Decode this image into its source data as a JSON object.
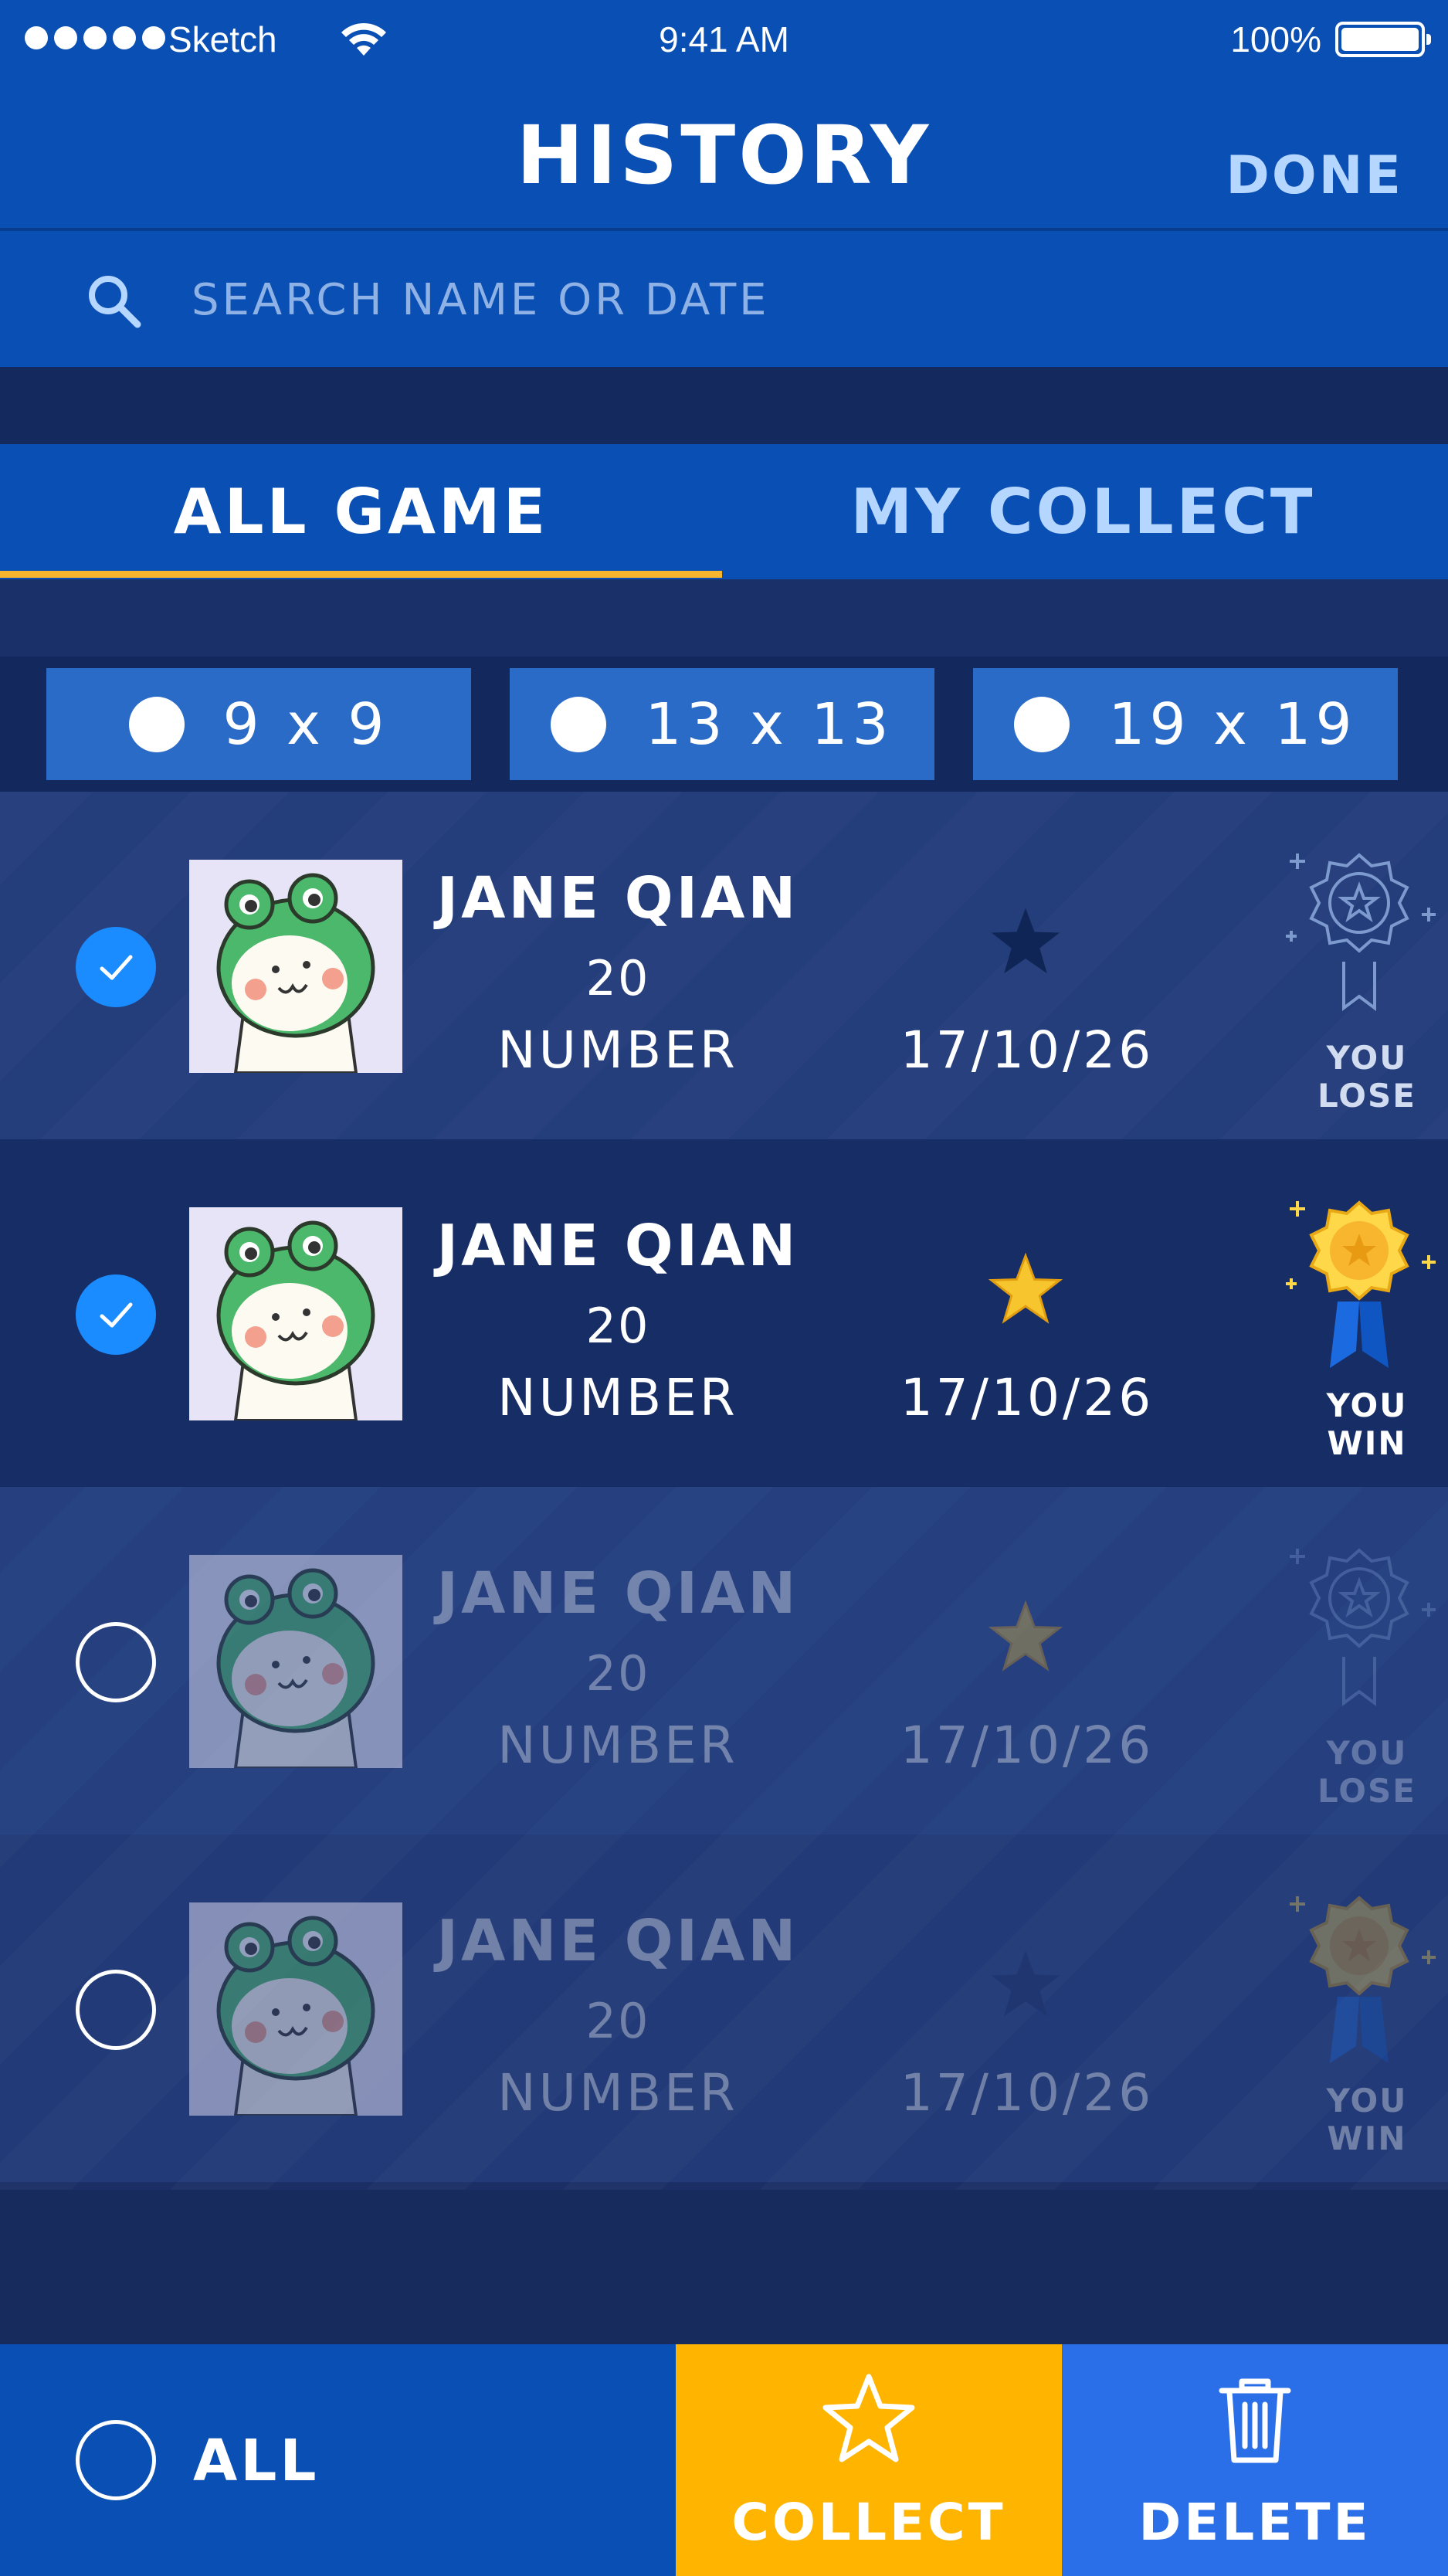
{
  "status_bar": {
    "carrier": "Sketch",
    "time": "9:41 AM",
    "battery": "100%",
    "battery_level": 1.0
  },
  "nav": {
    "title": "HISTORY",
    "done_label": "DONE"
  },
  "search": {
    "placeholder": "SEARCH NAME OR DATE"
  },
  "tabs": [
    {
      "label": "ALL GAME",
      "active": true
    },
    {
      "label": "MY COLLECT",
      "active": false
    }
  ],
  "board_sizes": [
    {
      "label": "9 x 9"
    },
    {
      "label": "13 x 13"
    },
    {
      "label": "19 x 19"
    }
  ],
  "games": [
    {
      "name": "JANE QIAN",
      "count": "20",
      "unit": "NUMBER",
      "date": "17/10/26",
      "result": "YOU LOSE",
      "selected": true,
      "collected": false
    },
    {
      "name": "JANE QIAN",
      "count": "20",
      "unit": "NUMBER",
      "date": "17/10/26",
      "result": "YOU WIN",
      "selected": true,
      "collected": true
    },
    {
      "name": "JANE QIAN",
      "count": "20",
      "unit": "NUMBER",
      "date": "17/10/26",
      "result": "YOU LOSE",
      "selected": false,
      "collected": true
    },
    {
      "name": "JANE QIAN",
      "count": "20",
      "unit": "NUMBER",
      "date": "17/10/26",
      "result": "YOU WIN",
      "selected": false,
      "collected": false
    }
  ],
  "bottom_bar": {
    "all_label": "ALL",
    "collect_label": "COLLECT",
    "delete_label": "DELETE"
  },
  "colors": {
    "primary": "#0a4fb3",
    "accent": "#f7b62d",
    "collect": "#ffb400",
    "delete": "#2a6fe8",
    "check": "#1a8cff"
  },
  "icons": [
    "search-icon",
    "wifi-icon",
    "check-icon",
    "star-icon",
    "medal-icon",
    "trash-icon"
  ]
}
